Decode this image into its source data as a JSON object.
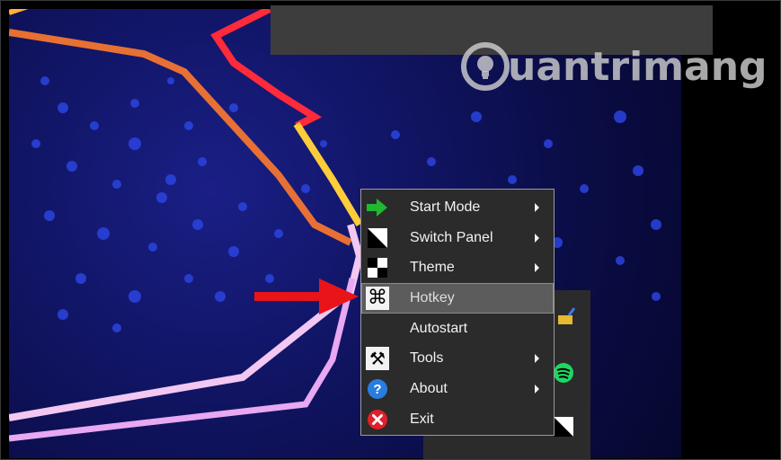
{
  "watermark": {
    "text": "uantrimang"
  },
  "context_menu": {
    "items": [
      {
        "label": "Start Mode",
        "icon": "green-arrow-icon",
        "has_submenu": true
      },
      {
        "label": "Switch Panel",
        "icon": "switch-panel-icon",
        "has_submenu": true
      },
      {
        "label": "Theme",
        "icon": "theme-checker-icon",
        "has_submenu": true
      },
      {
        "label": "Hotkey",
        "icon": "command-key-icon",
        "has_submenu": false,
        "highlighted": true
      },
      {
        "label": "Autostart",
        "icon": "",
        "has_submenu": false
      },
      {
        "label": "Tools",
        "icon": "tools-icon",
        "has_submenu": true
      },
      {
        "label": "About",
        "icon": "info-icon",
        "has_submenu": true
      },
      {
        "label": "Exit",
        "icon": "exit-icon",
        "has_submenu": false
      }
    ]
  },
  "colors": {
    "menu_bg": "#2b2b2b",
    "highlight_bg": "#5c5c5c",
    "pointer_arrow": "#e8141a"
  }
}
